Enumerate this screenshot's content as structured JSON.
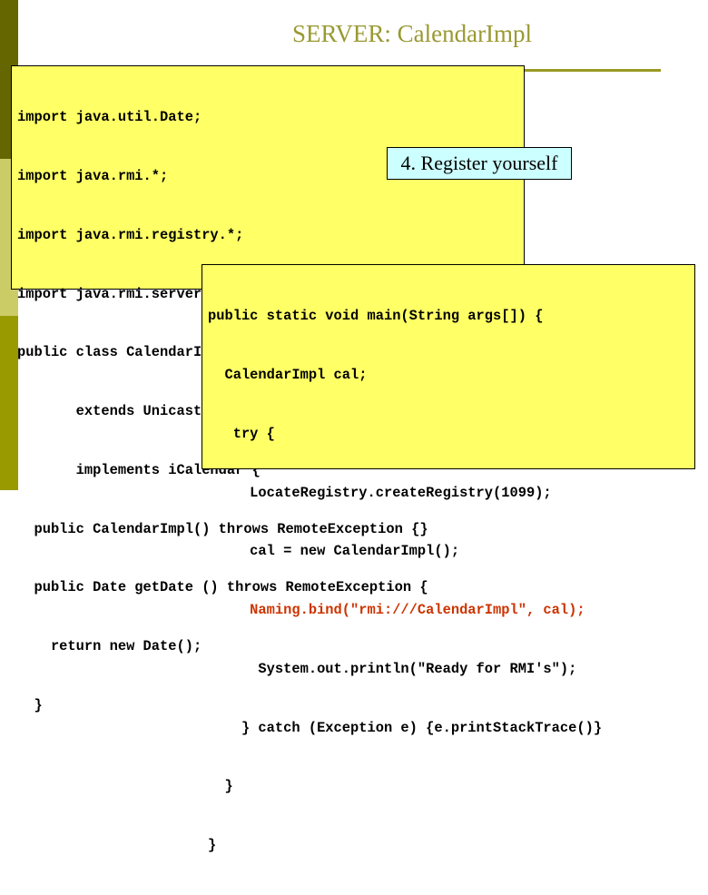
{
  "slide": {
    "title": "SERVER: CalendarImpl",
    "colors": {
      "sidebar_dark": "#666600",
      "sidebar_light": "#cccc66",
      "sidebar_mid": "#999900",
      "title": "#999933",
      "code_box_bg": "#ffff66",
      "callout_bg": "#ccffff",
      "highlight_code": "#cc3300"
    }
  },
  "class_code": {
    "lines": [
      "import java.util.Date;",
      "import java.rmi.*;",
      "import java.rmi.registry.*;",
      "import java.rmi.server.*;",
      "public class CalendarImpl",
      "       extends UnicastRemoteObject",
      "       implements iCalendar {",
      "  public CalendarImpl() throws RemoteException {}",
      "  public Date getDate () throws RemoteException {",
      "    return new Date();",
      "  }"
    ]
  },
  "callout": {
    "text": "4. Register yourself"
  },
  "main_code": {
    "lines": [
      "public static void main(String args[]) {",
      "  CalendarImpl cal;",
      "   try {",
      "     LocateRegistry.createRegistry(1099);",
      "     cal = new CalendarImpl();",
      "     Naming.bind(\"rmi:///CalendarImpl\", cal);",
      "      System.out.println(\"Ready for RMI's\");",
      "    } catch (Exception e) {e.printStackTrace()}",
      "  }",
      "}"
    ],
    "highlighted_line_index": 5
  }
}
